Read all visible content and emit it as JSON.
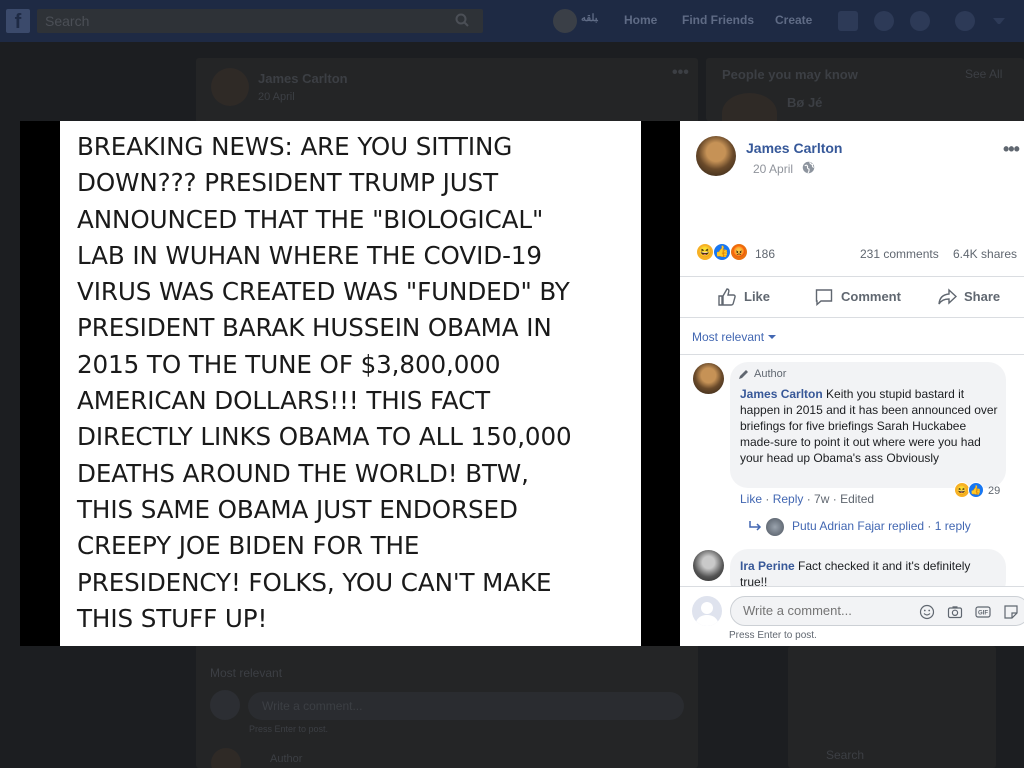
{
  "topnav": {
    "search_placeholder": "Search",
    "profile_name": "ﺒﻠﻘﻪ",
    "home": "Home",
    "find_friends": "Find Friends",
    "create": "Create"
  },
  "background": {
    "post_author": "James Carlton",
    "post_date": "20 April",
    "pymk_title": "People you may know",
    "pymk_see_all": "See All",
    "pymk_person": "Bø Jé",
    "most_relevant": "Most relevant",
    "comment_placeholder": "Write a comment...",
    "press_enter": "Press Enter to post.",
    "author_tag": "Author",
    "search_label": "Search"
  },
  "photo": {
    "lines": [
      "BREAKING NEWS: ARE YOU SITTING",
      "DOWN??? PRESIDENT TRUMP JUST",
      "ANNOUNCED THAT THE \"BIOLOGICAL\"",
      "LAB IN WUHAN WHERE THE COVID-19",
      "VIRUS WAS CREATED WAS \"FUNDED\" BY",
      "PRESIDENT BARAK HUSSEIN OBAMA IN",
      "2015 TO THE TUNE OF $3,800,000",
      "AMERICAN DOLLARS!!! THIS FACT",
      "DIRECTLY LINKS OBAMA TO ALL 150,000",
      "DEATHS AROUND THE WORLD! BTW,",
      "THIS SAME OBAMA JUST ENDORSED",
      "CREEPY JOE BIDEN FOR THE",
      "PRESIDENCY! FOLKS, YOU CAN'T MAKE",
      "THIS STUFF UP!"
    ]
  },
  "side": {
    "author": "James Carlton",
    "date": "20 April",
    "reaction_count": "186",
    "comments": "231 comments",
    "shares": "6.4K shares",
    "like": "Like",
    "comment": "Comment",
    "share": "Share",
    "sort": "Most relevant",
    "comment1": {
      "tag": "Author",
      "name": "James Carlton",
      "text": "Keith you stupid bastard it happen in 2015 and it has been announced over briefings for five briefings Sarah Huckabee made-sure to point it out where were you had your head up Obama's ass Obviously",
      "like": "Like",
      "reply": "Reply",
      "age": "7w",
      "edited": "Edited",
      "reactions": "29",
      "reply_name": "Putu Adrian Fajar",
      "replied": "replied",
      "reply_count": "1 reply"
    },
    "comment2": {
      "name": "Ira Perine",
      "text": "Fact checked it and it's definitely true!!"
    },
    "compose_placeholder": "Write a comment...",
    "press_enter": "Press Enter to post."
  }
}
